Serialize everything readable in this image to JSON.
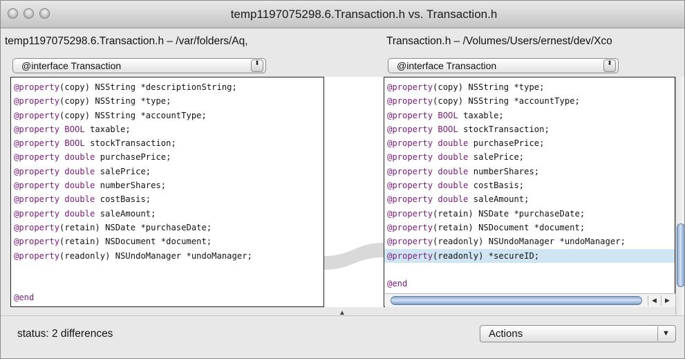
{
  "window": {
    "title": "temp1197075298.6.Transaction.h vs. Transaction.h"
  },
  "left": {
    "path": "temp1197075298.6.Transaction.h – /var/folders/Aq,",
    "symbol_popup": "@interface Transaction",
    "lines": [
      {
        "kw": "@property",
        "rest": "(copy) NSString *descriptionString;"
      },
      {
        "kw": "@property",
        "rest": "(copy) NSString *type;"
      },
      {
        "kw": "@property",
        "rest": "(copy) NSString *accountType;"
      },
      {
        "kw": "@property BOOL",
        "rest": " taxable;"
      },
      {
        "kw": "@property BOOL",
        "rest": " stockTransaction;"
      },
      {
        "kw": "@property double",
        "rest": " purchasePrice;"
      },
      {
        "kw": "@property double",
        "rest": " salePrice;"
      },
      {
        "kw": "@property double",
        "rest": " numberShares;"
      },
      {
        "kw": "@property double",
        "rest": " costBasis;"
      },
      {
        "kw": "@property double",
        "rest": " saleAmount;"
      },
      {
        "kw": "@property",
        "rest": "(retain) NSDate *purchaseDate;"
      },
      {
        "kw": "@property",
        "rest": "(retain) NSDocument *document;"
      },
      {
        "kw": "@property",
        "rest": "(readonly) NSUndoManager *undoManager;"
      }
    ],
    "end": "@end"
  },
  "right": {
    "path": "Transaction.h – /Volumes/Users/ernest/dev/Xco",
    "symbol_popup": "@interface Transaction",
    "lines": [
      {
        "kw": "@property",
        "rest": "(copy) NSString *type;"
      },
      {
        "kw": "@property",
        "rest": "(copy) NSString *accountType;"
      },
      {
        "kw": "@property BOOL",
        "rest": " taxable;"
      },
      {
        "kw": "@property BOOL",
        "rest": " stockTransaction;"
      },
      {
        "kw": "@property double",
        "rest": " purchasePrice;"
      },
      {
        "kw": "@property double",
        "rest": " salePrice;"
      },
      {
        "kw": "@property double",
        "rest": " numberShares;"
      },
      {
        "kw": "@property double",
        "rest": " costBasis;"
      },
      {
        "kw": "@property double",
        "rest": " saleAmount;"
      },
      {
        "kw": "@property",
        "rest": "(retain) NSDate *purchaseDate;"
      },
      {
        "kw": "@property",
        "rest": "(retain) NSDocument *document;"
      },
      {
        "kw": "@property",
        "rest": "(readonly) NSUndoManager *undoManager;"
      },
      {
        "kw": "@property",
        "rest": "(readonly) *secureID;"
      }
    ],
    "end": "@end"
  },
  "footer": {
    "status": "status: 2 differences",
    "actions_label": "Actions"
  },
  "icons": {
    "popup_arrows": "⬍",
    "dropdown_arrow": "▼",
    "scroll_left": "◀",
    "scroll_right": "▶",
    "splitter": "▲"
  },
  "colors": {
    "keyword": "#7a1a7a",
    "highlight": "#cfe6f2"
  }
}
